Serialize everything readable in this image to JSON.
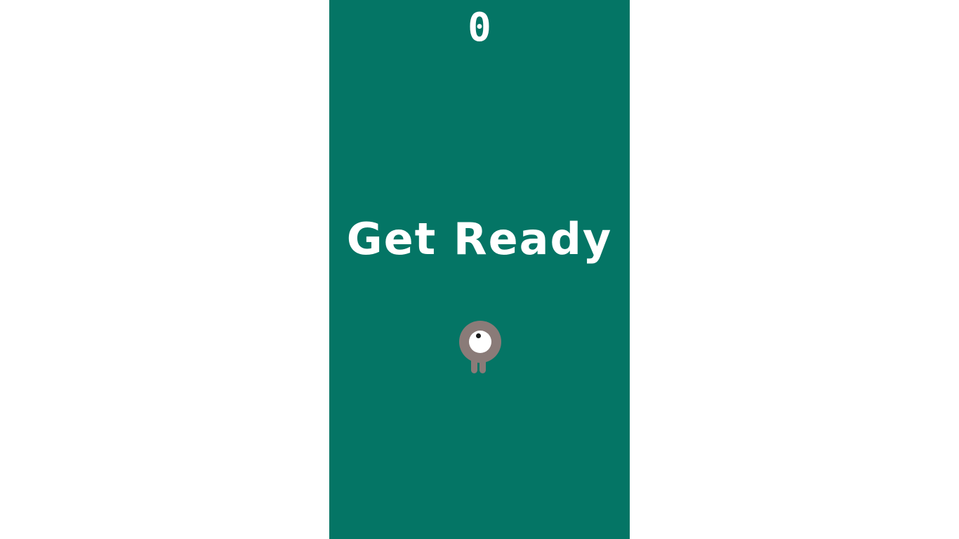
{
  "game": {
    "score": "0",
    "status_message": "Get Ready",
    "player_icon": "one-eyed-creature-icon"
  },
  "colors": {
    "playfield_background": "#047565",
    "page_background": "#ffffff",
    "text": "#ffffff",
    "player_body": "#8a7b78",
    "player_eye": "#ffffff",
    "player_pupil": "#1a1a1a"
  }
}
